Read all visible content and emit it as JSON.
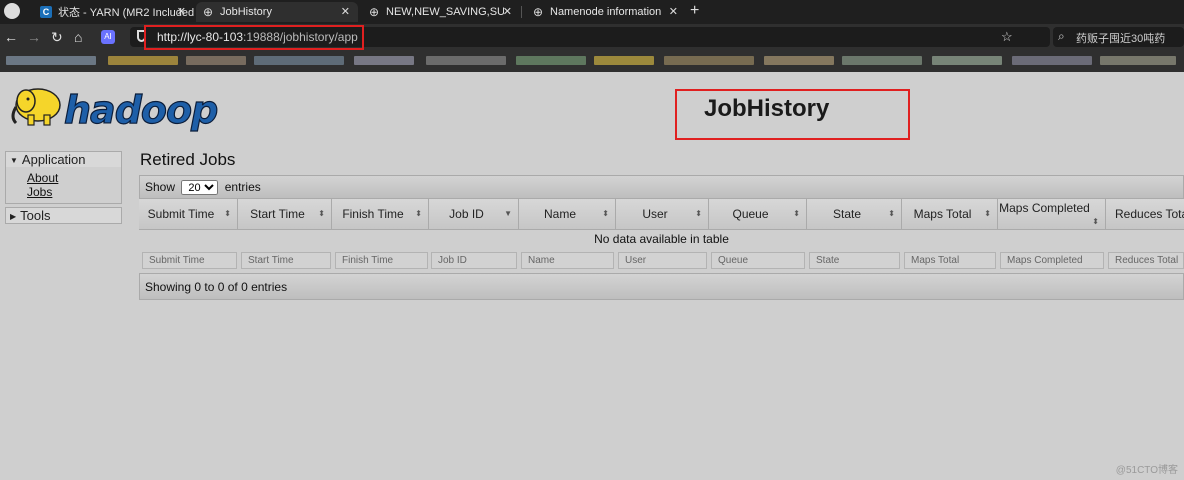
{
  "browser": {
    "tabs": [
      {
        "label": "状态 - YARN (MR2 Included",
        "icon": "c-icon",
        "active": false
      },
      {
        "label": "JobHistory",
        "icon": "globe-icon",
        "active": true
      },
      {
        "label": "NEW,NEW_SAVING,SUBMI",
        "icon": "globe-icon",
        "active": false
      },
      {
        "label": "Namenode information",
        "icon": "globe-icon",
        "active": false
      }
    ],
    "new_tab": "+",
    "url_host": "http://lyc-80-103",
    "url_rest": ":19888/jobhistory/app",
    "search_placeholder": "药贩子囤近30吨药",
    "ai_badge": "AI"
  },
  "page": {
    "title": "JobHistory",
    "section_title": "Retired Jobs"
  },
  "sidebar": {
    "application": {
      "label": "Application",
      "links": [
        "About",
        "Jobs"
      ]
    },
    "tools": {
      "label": "Tools"
    }
  },
  "table": {
    "show_label": "Show",
    "entries_label": "entries",
    "page_length": "20",
    "columns": [
      "Submit Time",
      "Start Time",
      "Finish Time",
      "Job ID",
      "Name",
      "User",
      "Queue",
      "State",
      "Maps Total",
      "Maps Completed",
      "Reduces Total"
    ],
    "empty_message": "No data available in table",
    "info": "Showing 0 to 0 of 0 entries"
  },
  "watermark": "@51CTO博客",
  "colors": {
    "highlight": "#e02020",
    "page_bg": "#cfcfcf",
    "chrome_bg": "#2f2f2f"
  }
}
